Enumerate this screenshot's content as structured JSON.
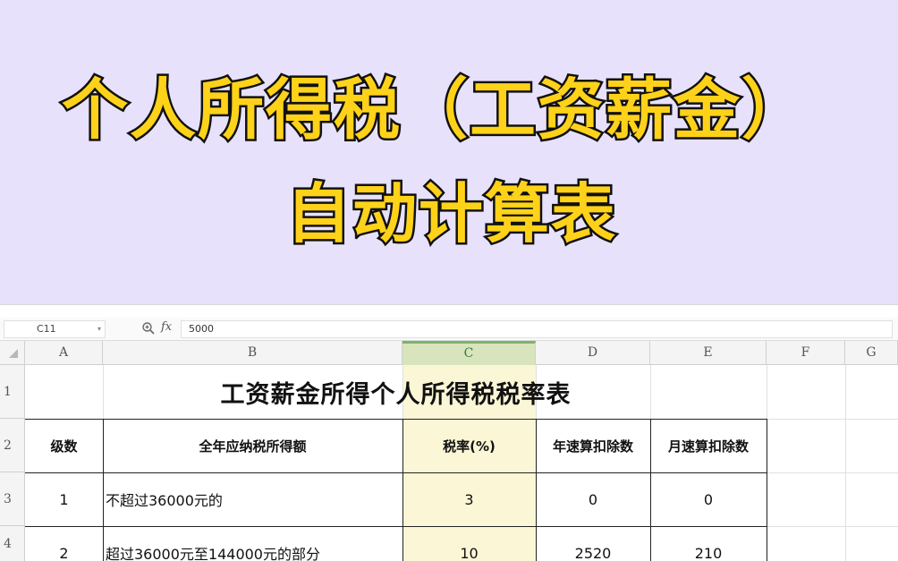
{
  "banner": {
    "line1": "个人所得税（工资薪金）",
    "line2": "自动计算表"
  },
  "formula_bar": {
    "cell_ref": "C11",
    "fx_label": "fx",
    "value": "5000"
  },
  "columns": [
    "A",
    "B",
    "C",
    "D",
    "E",
    "F",
    "G"
  ],
  "rows": [
    "1",
    "2",
    "3",
    "4"
  ],
  "table": {
    "title": "工资薪金所得个人所得税税率表",
    "headers": [
      "级数",
      "全年应纳税所得额",
      "税率(%)",
      "年速算扣除数",
      "月速算扣除数"
    ],
    "rows": [
      [
        "1",
        "不超过36000元的",
        "3",
        "0",
        "0"
      ],
      [
        "2",
        "超过36000元至144000元的部分",
        "10",
        "2520",
        "210"
      ]
    ]
  },
  "colors": {
    "banner_bg": "#e8e1fb",
    "banner_text": "#ffd21a",
    "selected_column": "#fbf6d6"
  }
}
